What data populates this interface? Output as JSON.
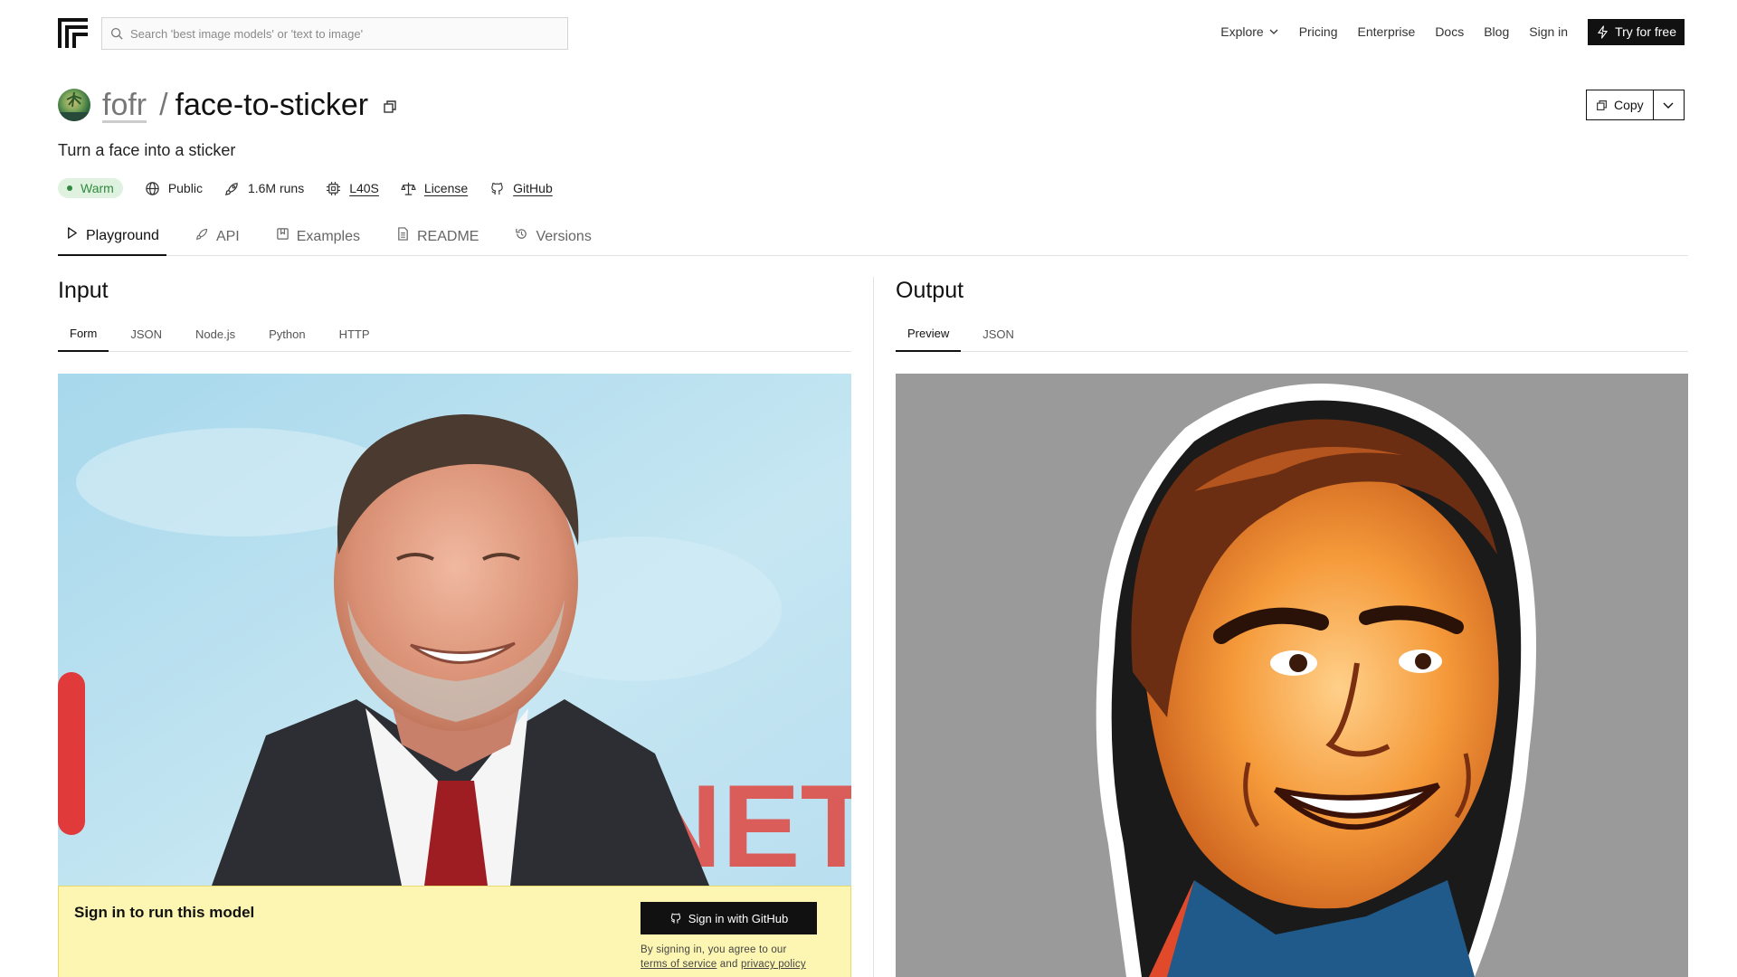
{
  "nav": {
    "search_placeholder": "Search 'best image models' or 'text to image'",
    "links": [
      "Explore",
      "Pricing",
      "Enterprise",
      "Docs",
      "Blog",
      "Sign in"
    ],
    "cta": "Try for free"
  },
  "model": {
    "owner": "fofr",
    "separator": "/",
    "name": "face-to-sticker",
    "description": "Turn a face into a sticker",
    "copy_label": "Copy",
    "status": "Warm",
    "visibility": "Public",
    "runs": "1.6M runs",
    "hardware": "L40S",
    "license": "License",
    "github": "GitHub"
  },
  "tabs": [
    "Playground",
    "API",
    "Examples",
    "README",
    "Versions"
  ],
  "input": {
    "title": "Input",
    "subtabs": [
      "Form",
      "JSON",
      "Node.js",
      "Python",
      "HTTP"
    ],
    "signin_title": "Sign in to run this model",
    "github_button": "Sign in with GitHub",
    "agree_text": "By signing in, you agree to our",
    "terms": "terms of service",
    "and": "and",
    "privacy": "privacy policy",
    "backdrop_text": "NETFL"
  },
  "output": {
    "title": "Output",
    "subtabs": [
      "Preview",
      "JSON"
    ]
  },
  "colors": {
    "accent": "#111111",
    "warm_bg": "#dff2df",
    "warm_fg": "#2f8a3d",
    "signin_bg": "#fdf6b2"
  }
}
